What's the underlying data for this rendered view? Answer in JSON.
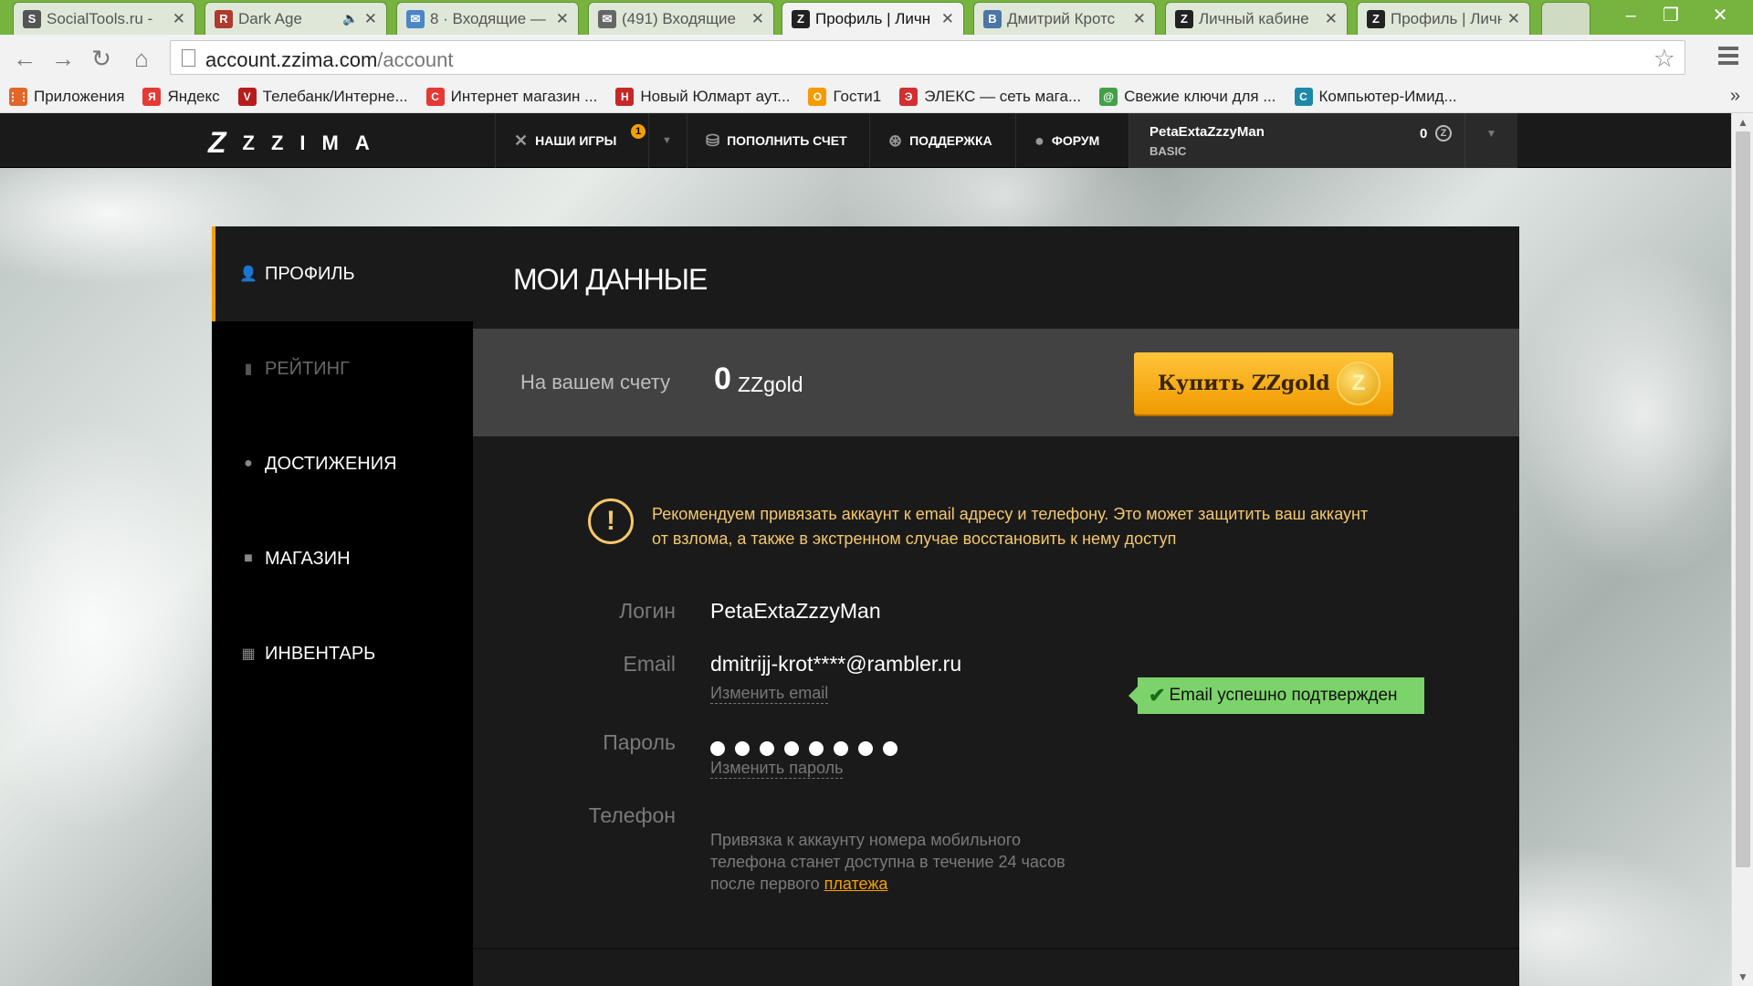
{
  "browser": {
    "tabs": [
      {
        "title": "SocialTools.ru -",
        "icon_color": "#555555",
        "icon": "S"
      },
      {
        "title": "Dark Age",
        "icon_color": "#b03a2e",
        "icon": "R",
        "muted_icon": "🔈"
      },
      {
        "title": "8 · Входящие —",
        "icon_color": "#4a86c8",
        "icon": "✉"
      },
      {
        "title": "(491) Входящие",
        "icon_color": "#666666",
        "icon": "✉"
      },
      {
        "title": "Профиль | Личн",
        "icon_color": "#222222",
        "icon": "Z",
        "active": true
      },
      {
        "title": "Дмитрий Кротс",
        "icon_color": "#4a76a8",
        "icon": "B"
      },
      {
        "title": "Личный кабине",
        "icon_color": "#222222",
        "icon": "Z"
      },
      {
        "title": "Профиль | Личн",
        "icon_color": "#222222",
        "icon": "Z"
      }
    ],
    "url_host": "account.zzima.com",
    "url_path": "/account",
    "bookmarks": [
      {
        "label": "Приложения",
        "icon_color": "#e0662a",
        "icon": "⋮⋮"
      },
      {
        "label": "Яндекс",
        "icon_color": "#e53935",
        "icon": "Я"
      },
      {
        "label": "Телебанк/Интерне...",
        "icon_color": "#b71c1c",
        "icon": "V"
      },
      {
        "label": "Интернет магазин ...",
        "icon_color": "#e53935",
        "icon": "C"
      },
      {
        "label": "Новый Юлмарт аут...",
        "icon_color": "#c62828",
        "icon": "H"
      },
      {
        "label": "Гости1",
        "icon_color": "#f59b00",
        "icon": "О"
      },
      {
        "label": "ЭЛЕКС — сеть мага...",
        "icon_color": "#d32f2f",
        "icon": "Э"
      },
      {
        "label": "Свежие ключи для ...",
        "icon_color": "#43a047",
        "icon": "@"
      },
      {
        "label": "Компьютер-Имид...",
        "icon_color": "#1e88a8",
        "icon": "C"
      }
    ],
    "bookmarks_more": "»"
  },
  "site": {
    "logo_mark": "Z",
    "logo_word": "ZZIMA",
    "nav": {
      "games": "НАШИ ИГРЫ",
      "games_badge": "1",
      "topup": "ПОПОЛНИТЬ СЧЕТ",
      "support": "ПОДДЕРЖКА",
      "forum": "ФОРУМ"
    },
    "user": {
      "name": "PetaExtaZzzyMan",
      "tier": "BASIC",
      "balance": "0",
      "coin": "Z"
    }
  },
  "sidebar": {
    "items": [
      {
        "label": "ПРОФИЛЬ",
        "icon": "user-icon",
        "active": true
      },
      {
        "label": "РЕЙТИНГ",
        "icon": "rating-icon",
        "disabled": true
      },
      {
        "label": "ДОСТИЖЕНИЯ",
        "icon": "achievement-icon"
      },
      {
        "label": "МАГАЗИН",
        "icon": "shop-bag-icon"
      },
      {
        "label": "ИНВЕНТАРЬ",
        "icon": "inventory-grid-icon"
      }
    ]
  },
  "main": {
    "title": "МОИ ДАННЫЕ",
    "balance_label": "На вашем счету",
    "balance_value": "0",
    "balance_currency": "ZZgold",
    "buy_button": "Купить ZZgold",
    "buy_coin": "Z",
    "notice": "Рекомендуем привязать аккаунт к email адресу и телефону. Это может защитить ваш аккаунт от взлома, а также в экстренном случае восстановить к нему доступ",
    "fields": {
      "login_label": "Логин",
      "login_value": "PetaExtaZzzyMan",
      "email_label": "Email",
      "email_value": "dmitrijj-krot****@rambler.ru",
      "email_change": "Изменить email",
      "email_status": "Email успешно подтвержден",
      "password_label": "Пароль",
      "password_change": "Изменить пароль",
      "phone_label": "Телефон",
      "phone_note": "Привязка к аккаунту номера мобильного телефона станет доступна в течение 24 часов после первого",
      "phone_link": "платежа"
    }
  }
}
